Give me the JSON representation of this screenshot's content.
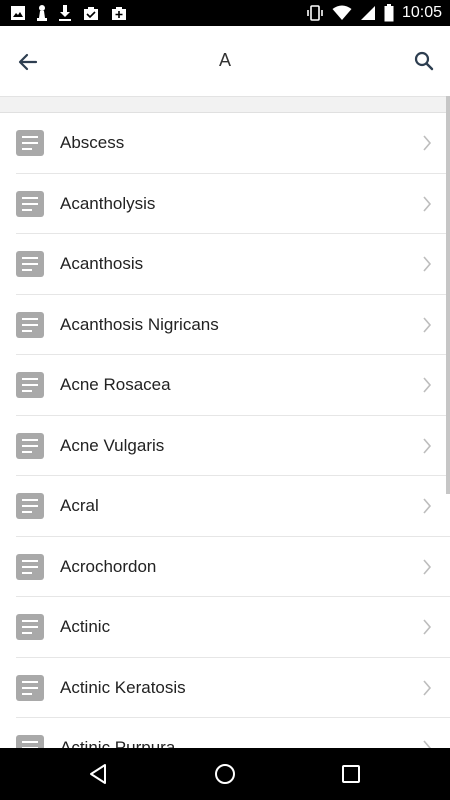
{
  "status_bar": {
    "time": "10:05",
    "left_icons": [
      "image-icon",
      "chess-pawn-icon",
      "download-icon",
      "briefcase-check-icon",
      "briefcase-add-icon"
    ],
    "right_icons": [
      "vibrate-icon",
      "wifi-icon",
      "signal-icon",
      "battery-icon"
    ]
  },
  "app_bar": {
    "title": "A",
    "back_icon": "arrow-left-icon",
    "search_icon": "search-icon"
  },
  "list": {
    "items": [
      {
        "label": "Abscess"
      },
      {
        "label": "Acantholysis"
      },
      {
        "label": "Acanthosis"
      },
      {
        "label": "Acanthosis Nigricans"
      },
      {
        "label": "Acne Rosacea"
      },
      {
        "label": "Acne Vulgaris"
      },
      {
        "label": "Acral"
      },
      {
        "label": "Acrochordon"
      },
      {
        "label": "Actinic"
      },
      {
        "label": "Actinic Keratosis"
      },
      {
        "label": "Actinic Purpura"
      }
    ]
  },
  "nav_bar": {
    "icons": [
      "nav-back-icon",
      "nav-home-icon",
      "nav-recent-apps-icon"
    ]
  }
}
